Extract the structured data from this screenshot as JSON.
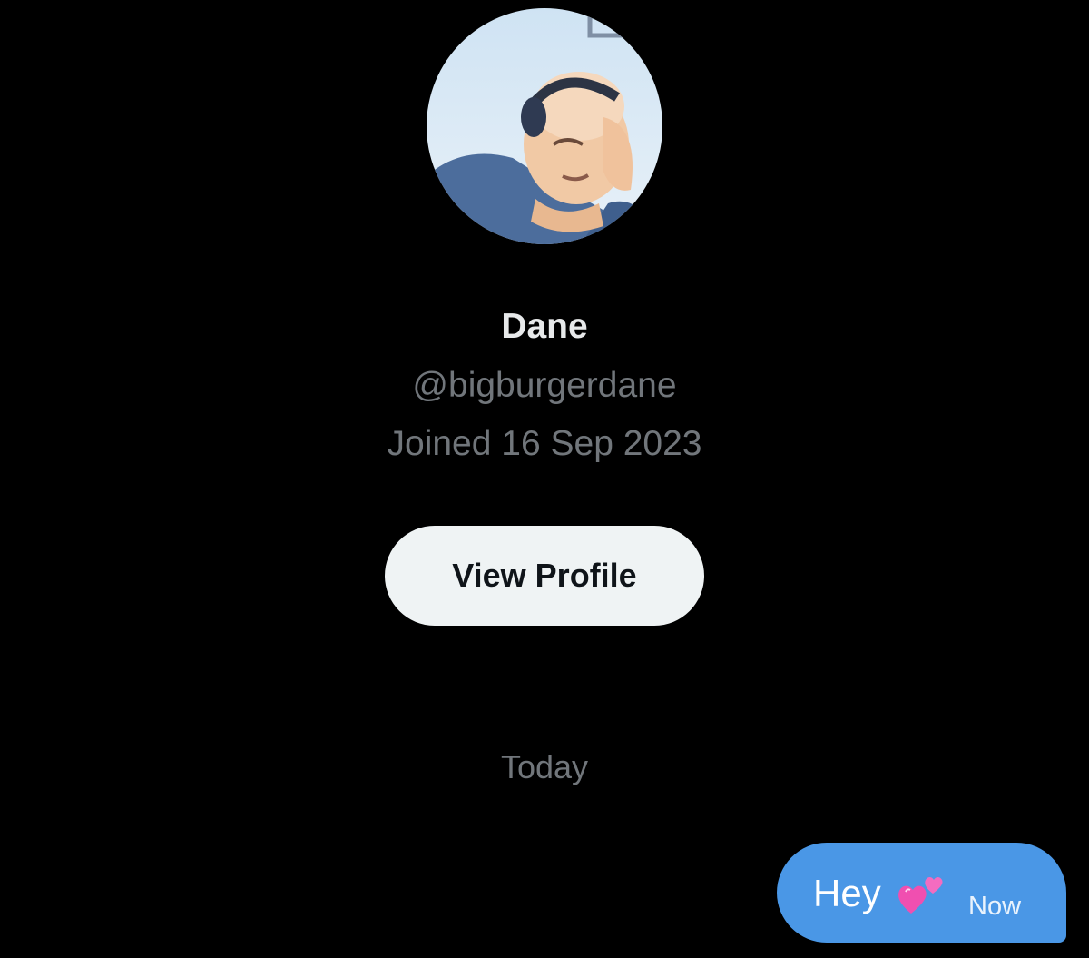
{
  "profile": {
    "display_name": "Dane",
    "handle": "@bigburgerdane",
    "joined": "Joined 16 Sep 2023",
    "view_profile_label": "View Profile"
  },
  "conversation": {
    "date_separator": "Today",
    "messages": [
      {
        "text": "Hey",
        "emoji_icon": "two-hearts-icon",
        "time": "Now",
        "direction": "outgoing"
      }
    ]
  },
  "colors": {
    "background": "#000000",
    "name": "#e7e9ea",
    "secondary_text": "#71767b",
    "button_bg": "#eff3f4",
    "bubble": "#4a97e6"
  }
}
